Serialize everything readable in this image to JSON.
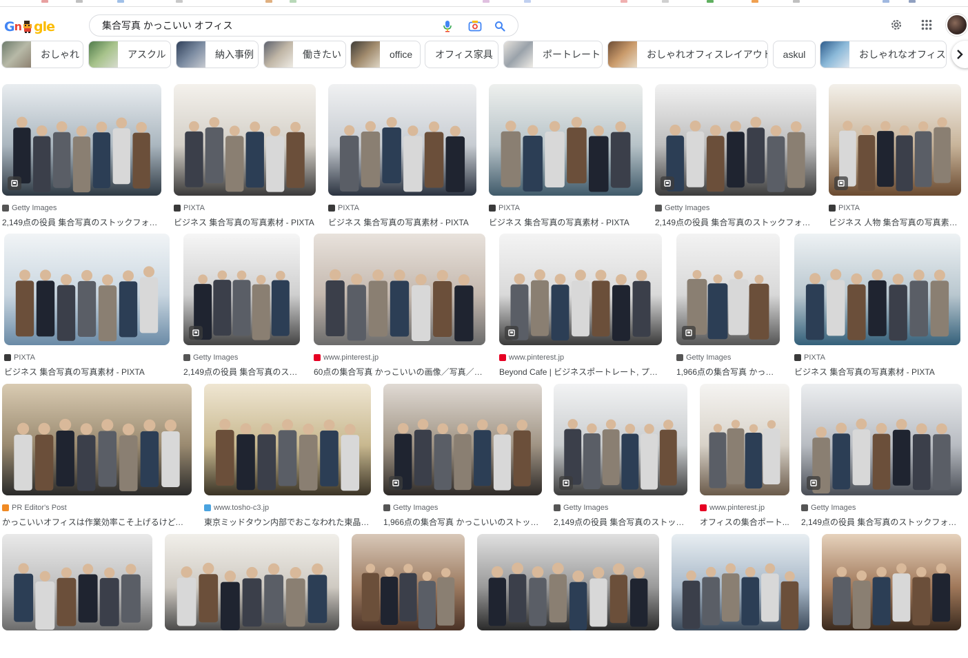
{
  "logo": {
    "text_left": "G",
    "text_mid": "n",
    "text_right": "gle"
  },
  "search": {
    "query": "集合写真 かっこいい オフィス"
  },
  "header_icons": [
    "settings-icon",
    "apps-grid-icon",
    "account-avatar"
  ],
  "chips": [
    {
      "label": "おしゃれ"
    },
    {
      "label": "アスクル"
    },
    {
      "label": "納入事例"
    },
    {
      "label": "働きたい"
    },
    {
      "label": "office"
    },
    {
      "label": "オフィス家具"
    },
    {
      "label": "ポートレート"
    },
    {
      "label": "おしゃれオフィスレイアウト"
    },
    {
      "label": "askul"
    },
    {
      "label": "おしゃれなオフィス"
    }
  ],
  "results": [
    {
      "source": "Getty Images",
      "title": "2,149点の役員 集合写真のストックフォト - ...",
      "fav": "#555555",
      "badge": true
    },
    {
      "source": "PIXTA",
      "title": "ビジネス 集合写真の写真素材 - PIXTA",
      "fav": "#3a3a3a",
      "badge": false
    },
    {
      "source": "PIXTA",
      "title": "ビジネス 集合写真の写真素材 - PIXTA",
      "fav": "#3a3a3a",
      "badge": false
    },
    {
      "source": "PIXTA",
      "title": "ビジネス 集合写真の写真素材 - PIXTA",
      "fav": "#3a3a3a",
      "badge": false
    },
    {
      "source": "Getty Images",
      "title": "2,149点の役員 集合写真のストックフォト - ...",
      "fav": "#555555",
      "badge": true
    },
    {
      "source": "PIXTA",
      "title": "ビジネス 人物 集合写真の写真素材 [...",
      "fav": "#3a3a3a",
      "badge": true
    },
    {
      "source": "PIXTA",
      "title": "ビジネス 集合写真の写真素材 - PIXTA",
      "fav": "#3a3a3a",
      "badge": false
    },
    {
      "source": "Getty Images",
      "title": "2,149点の役員 集合写真のスト...",
      "fav": "#555555",
      "badge": true
    },
    {
      "source": "www.pinterest.jp",
      "title": "60点の集合写真 かっこいいの画像／写真／イメ...",
      "fav": "#e60023",
      "badge": false
    },
    {
      "source": "www.pinterest.jp",
      "title": "Beyond Cafe | ビジネスポートレート, プロフ...",
      "fav": "#e60023",
      "badge": true
    },
    {
      "source": "Getty Images",
      "title": "1,966点の集合写真 かっこ...",
      "fav": "#555555",
      "badge": true
    },
    {
      "source": "PIXTA",
      "title": "ビジネス 集合写真の写真素材 - PIXTA",
      "fav": "#3a3a3a",
      "badge": false
    },
    {
      "source": "PR Editor's Post",
      "title": "かっこいいオフィスは作業効率こそ上げるけど、創...",
      "fav": "#f08a24",
      "badge": false
    },
    {
      "source": "www.tosho-c3.jp",
      "title": "東京ミッドタウン内部でおこなわれた東晶貿...",
      "fav": "#4aa3df",
      "badge": false
    },
    {
      "source": "Getty Images",
      "title": "1,966点の集合写真 かっこいいのストック...",
      "fav": "#555555",
      "badge": true
    },
    {
      "source": "Getty Images",
      "title": "2,149点の役員 集合写真のストック...",
      "fav": "#555555",
      "badge": true
    },
    {
      "source": "www.pinterest.jp",
      "title": "オフィスの集合ポート...",
      "fav": "#e60023",
      "badge": false
    },
    {
      "source": "Getty Images",
      "title": "2,149点の役員 集合写真のストックフォト - ...",
      "fav": "#555555",
      "badge": true
    },
    {
      "source": "",
      "title": "",
      "fav": "#555555",
      "badge": false
    },
    {
      "source": "",
      "title": "",
      "fav": "#555555",
      "badge": false
    },
    {
      "source": "",
      "title": "",
      "fav": "#555555",
      "badge": false
    },
    {
      "source": "",
      "title": "",
      "fav": "#555555",
      "badge": false
    },
    {
      "source": "",
      "title": "",
      "fav": "#555555",
      "badge": false
    },
    {
      "source": "",
      "title": "",
      "fav": "#555555",
      "badge": false
    }
  ]
}
